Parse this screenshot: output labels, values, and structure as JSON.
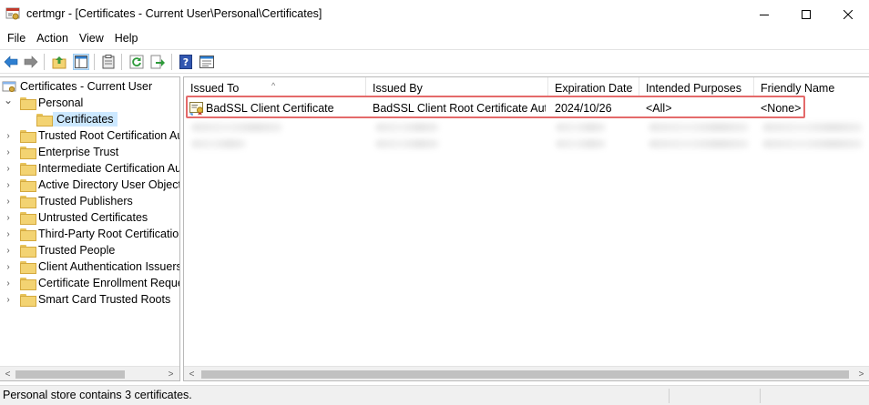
{
  "window": {
    "title": "certmgr - [Certificates - Current User\\Personal\\Certificates]",
    "min_glyph": "—",
    "max_glyph": "☐",
    "close_glyph": "✕"
  },
  "menu": [
    "File",
    "Action",
    "View",
    "Help"
  ],
  "tree": {
    "root": "Certificates - Current User",
    "items": [
      {
        "label": "Personal",
        "expanded": true
      },
      {
        "label": "Certificates",
        "selected": true
      },
      {
        "label": "Trusted Root Certification Au"
      },
      {
        "label": "Enterprise Trust"
      },
      {
        "label": "Intermediate Certification Au"
      },
      {
        "label": "Active Directory User Object"
      },
      {
        "label": "Trusted Publishers"
      },
      {
        "label": "Untrusted Certificates"
      },
      {
        "label": "Third-Party Root Certification"
      },
      {
        "label": "Trusted People"
      },
      {
        "label": "Client Authentication Issuers"
      },
      {
        "label": "Certificate Enrollment Reques"
      },
      {
        "label": "Smart Card Trusted Roots"
      }
    ]
  },
  "table": {
    "columns": [
      "Issued To",
      "Issued By",
      "Expiration Date",
      "Intended Purposes",
      "Friendly Name"
    ],
    "rows": [
      {
        "issued_to": "BadSSL Client Certificate",
        "issued_by": "BadSSL Client Root Certificate Aut...",
        "expiration": "2024/10/26",
        "purposes": "<All>",
        "friendly": "<None>"
      }
    ]
  },
  "status": {
    "text": "Personal store contains 3 certificates."
  },
  "colors": {
    "highlight_border": "#e46a6a",
    "selection": "#cce8ff",
    "folder": "#f3d372"
  }
}
